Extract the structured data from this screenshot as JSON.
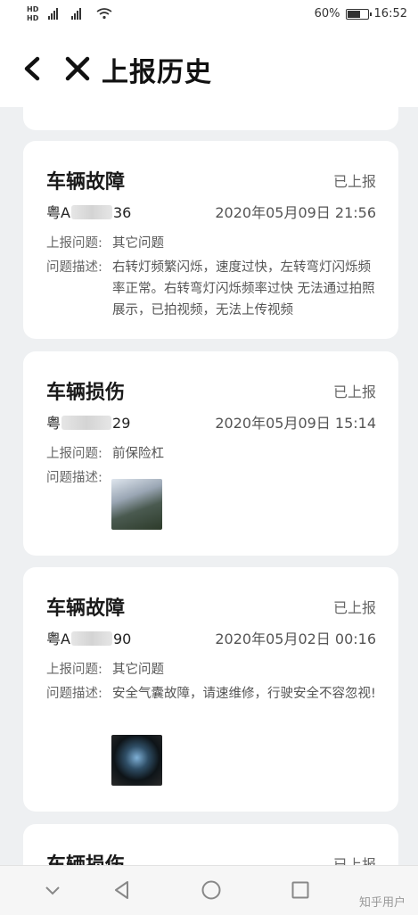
{
  "status_bar": {
    "network": "4G",
    "battery": "60%",
    "battery_level": 0.6,
    "time": "16:52"
  },
  "header": {
    "title": "上报历史"
  },
  "labels": {
    "issue": "上报问题:",
    "description": "问题描述:"
  },
  "records": [
    {
      "title": "车辆故障",
      "status": "已上报",
      "plate_prefix": "粤A",
      "plate_suffix": "36",
      "time": "2020年05月09日 21:56",
      "issue": "其它问题",
      "description": "右转灯频繁闪烁，速度过快，左转弯灯闪烁频率正常。右转弯灯闪烁频率过快 无法通过拍照展示，已拍视频，无法上传视频"
    },
    {
      "title": "车辆损伤",
      "status": "已上报",
      "plate_prefix": "粤",
      "plate_suffix": "29",
      "time": "2020年05月09日 15:14",
      "issue": "前保险杠",
      "description": ""
    },
    {
      "title": "车辆故障",
      "status": "已上报",
      "plate_prefix": "粤A",
      "plate_suffix": "90",
      "time": "2020年05月02日 00:16",
      "issue": "其它问题",
      "description": "安全气囊故障，请速维修，行驶安全不容忽视!"
    },
    {
      "title": "车辆损伤",
      "status": "已上报"
    }
  ],
  "watermark": "知乎用户"
}
